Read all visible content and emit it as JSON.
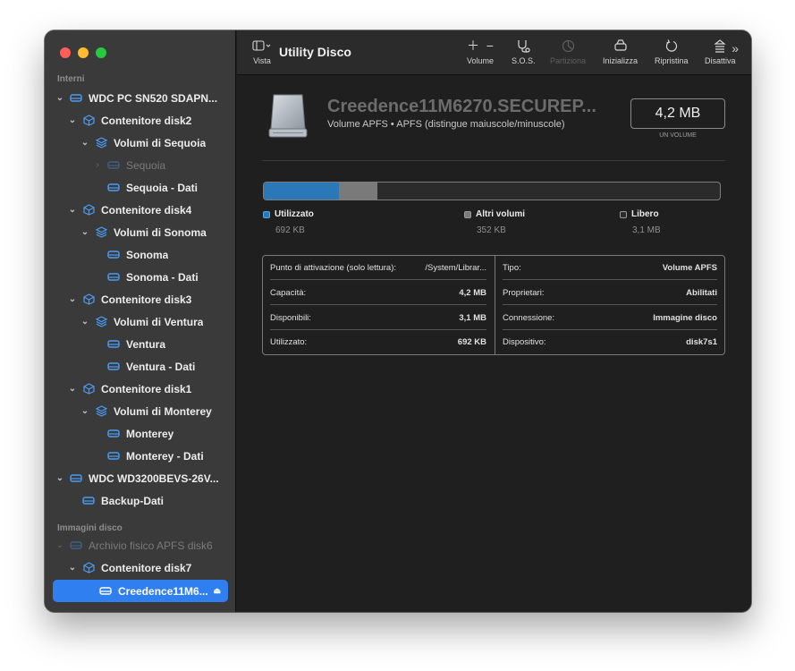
{
  "colors": {
    "used": "#2a78b8",
    "other": "#7a7a7a",
    "free": "#2b2b2b",
    "selection": "#2f7ff0"
  },
  "sidebar": {
    "sections": {
      "internal": "Interni",
      "images": "Immagini disco"
    },
    "items": [
      {
        "label": "WDC PC SN520 SDAPN...",
        "icon": "drive-icon",
        "chevron": "down"
      },
      {
        "label": "Contenitore disk2",
        "icon": "container-icon",
        "chevron": "down"
      },
      {
        "label": "Volumi di Sequoia",
        "icon": "volume-group-icon",
        "chevron": "down"
      },
      {
        "label": "Sequoia",
        "icon": "volume-icon",
        "chevron": "right",
        "dimmed": true
      },
      {
        "label": "Sequoia - Dati",
        "icon": "volume-icon"
      },
      {
        "label": "Contenitore disk4",
        "icon": "container-icon",
        "chevron": "down"
      },
      {
        "label": "Volumi di Sonoma",
        "icon": "volume-group-icon",
        "chevron": "down"
      },
      {
        "label": "Sonoma",
        "icon": "volume-icon"
      },
      {
        "label": "Sonoma - Dati",
        "icon": "volume-icon"
      },
      {
        "label": "Contenitore disk3",
        "icon": "container-icon",
        "chevron": "down"
      },
      {
        "label": "Volumi di Ventura",
        "icon": "volume-group-icon",
        "chevron": "down"
      },
      {
        "label": "Ventura",
        "icon": "volume-icon"
      },
      {
        "label": "Ventura - Dati",
        "icon": "volume-icon"
      },
      {
        "label": "Contenitore disk1",
        "icon": "container-icon",
        "chevron": "down"
      },
      {
        "label": "Volumi di Monterey",
        "icon": "volume-group-icon",
        "chevron": "down"
      },
      {
        "label": "Monterey",
        "icon": "volume-icon"
      },
      {
        "label": "Monterey - Dati",
        "icon": "volume-icon"
      },
      {
        "label": "WDC WD3200BEVS-26V...",
        "icon": "drive-icon",
        "chevron": "down"
      },
      {
        "label": "Backup-Dati",
        "icon": "volume-icon"
      },
      {
        "label": "Archivio fisico APFS disk6",
        "icon": "drive-icon",
        "chevron": "down",
        "dimmed": true
      },
      {
        "label": "Contenitore disk7",
        "icon": "container-icon",
        "chevron": "down"
      },
      {
        "label": "Creedence11M6...",
        "icon": "volume-icon",
        "selected": true
      }
    ]
  },
  "toolbar": {
    "view_label": "Vista",
    "app_title": "Utility Disco",
    "volume_label": "Volume",
    "sos_label": "S.O.S.",
    "partition_label": "Partiziona",
    "erase_label": "Inizializza",
    "restore_label": "Ripristina",
    "unmount_label": "Disattiva"
  },
  "volume": {
    "name": "Creedence11M6270.SECUREP...",
    "subtitle": "Volume APFS • APFS (distingue maiuscole/minuscole)",
    "size": "4,2 MB",
    "size_caption": "UN VOLUME"
  },
  "usage": {
    "used_fraction": 0.165,
    "other_fraction": 0.084,
    "legend": [
      {
        "label": "Utilizzato",
        "value": "692 KB"
      },
      {
        "label": "Altri volumi",
        "value": "352 KB"
      },
      {
        "label": "Libero",
        "value": "3,1 MB"
      }
    ]
  },
  "info": {
    "left": [
      {
        "key": "Punto di attivazione (solo lettura):",
        "value": "/System/Librar..."
      },
      {
        "key": "Capacità:",
        "value": "4,2 MB"
      },
      {
        "key": "Disponibili:",
        "value": "3,1 MB"
      },
      {
        "key": "Utilizzato:",
        "value": "692 KB"
      }
    ],
    "right": [
      {
        "key": "Tipo:",
        "value": "Volume APFS"
      },
      {
        "key": "Proprietari:",
        "value": "Abilitati"
      },
      {
        "key": "Connessione:",
        "value": "Immagine disco"
      },
      {
        "key": "Dispositivo:",
        "value": "disk7s1"
      }
    ]
  }
}
